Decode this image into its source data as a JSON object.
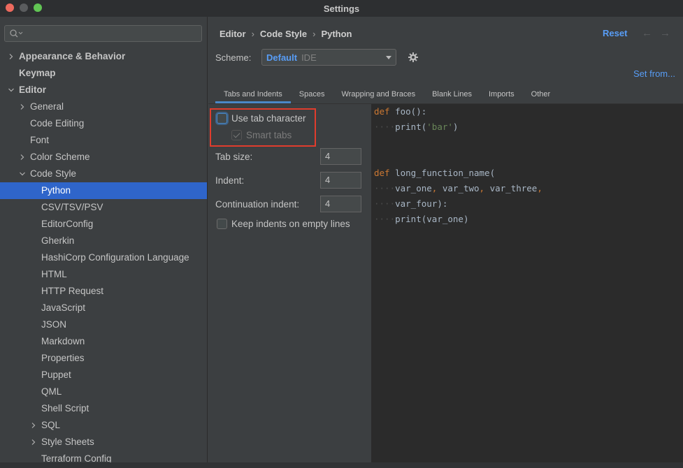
{
  "window": {
    "title": "Settings"
  },
  "search": {
    "placeholder": ""
  },
  "sidebar": {
    "items": [
      {
        "label": "Appearance & Behavior",
        "bold": true,
        "chevron": "right",
        "indent": 0
      },
      {
        "label": "Keymap",
        "bold": true,
        "chevron": "",
        "indent": 0
      },
      {
        "label": "Editor",
        "bold": true,
        "chevron": "down",
        "indent": 0
      },
      {
        "label": "General",
        "chevron": "right",
        "indent": 1
      },
      {
        "label": "Code Editing",
        "chevron": "",
        "indent": 1
      },
      {
        "label": "Font",
        "chevron": "",
        "indent": 1
      },
      {
        "label": "Color Scheme",
        "chevron": "right",
        "indent": 1
      },
      {
        "label": "Code Style",
        "chevron": "down",
        "indent": 1
      },
      {
        "label": "Python",
        "chevron": "",
        "indent": 2,
        "selected": true
      },
      {
        "label": "CSV/TSV/PSV",
        "chevron": "",
        "indent": 2
      },
      {
        "label": "EditorConfig",
        "chevron": "",
        "indent": 2
      },
      {
        "label": "Gherkin",
        "chevron": "",
        "indent": 2
      },
      {
        "label": "HashiCorp Configuration Language",
        "chevron": "",
        "indent": 2
      },
      {
        "label": "HTML",
        "chevron": "",
        "indent": 2
      },
      {
        "label": "HTTP Request",
        "chevron": "",
        "indent": 2
      },
      {
        "label": "JavaScript",
        "chevron": "",
        "indent": 2
      },
      {
        "label": "JSON",
        "chevron": "",
        "indent": 2
      },
      {
        "label": "Markdown",
        "chevron": "",
        "indent": 2
      },
      {
        "label": "Properties",
        "chevron": "",
        "indent": 2
      },
      {
        "label": "Puppet",
        "chevron": "",
        "indent": 2
      },
      {
        "label": "QML",
        "chevron": "",
        "indent": 2
      },
      {
        "label": "Shell Script",
        "chevron": "",
        "indent": 2
      },
      {
        "label": "SQL",
        "chevron": "right",
        "indent": 2
      },
      {
        "label": "Style Sheets",
        "chevron": "right",
        "indent": 2
      },
      {
        "label": "Terraform Config",
        "chevron": "",
        "indent": 2
      }
    ]
  },
  "breadcrumb": {
    "items": [
      "Editor",
      "Code Style",
      "Python"
    ]
  },
  "header": {
    "reset_label": "Reset",
    "back_icon": "arrow-left-icon",
    "forward_icon": "arrow-right-icon"
  },
  "scheme": {
    "label": "Scheme:",
    "name": "Default",
    "sub": "IDE",
    "set_from": "Set from..."
  },
  "tabs": [
    {
      "label": "Tabs and Indents",
      "active": true
    },
    {
      "label": "Spaces"
    },
    {
      "label": "Wrapping and Braces"
    },
    {
      "label": "Blank Lines"
    },
    {
      "label": "Imports"
    },
    {
      "label": "Other"
    }
  ],
  "options": {
    "use_tab_character": {
      "label": "Use tab character",
      "checked": false
    },
    "smart_tabs": {
      "label": "Smart tabs",
      "checked": true,
      "disabled": true
    },
    "tab_size": {
      "label": "Tab size:",
      "value": "4"
    },
    "indent": {
      "label": "Indent:",
      "value": "4"
    },
    "continuation_indent": {
      "label": "Continuation indent:",
      "value": "4"
    },
    "keep_indents": {
      "label": "Keep indents on empty lines",
      "checked": false
    }
  },
  "preview": {
    "lines": [
      "def foo():",
      "    print('bar')",
      "",
      "",
      "def long_function_name(",
      "    var_one, var_two, var_three,",
      "    var_four):",
      "    print(var_one)"
    ]
  },
  "colors": {
    "accent": "#589df6",
    "selection": "#2f65ca",
    "highlight_border": "#e03c2d"
  }
}
